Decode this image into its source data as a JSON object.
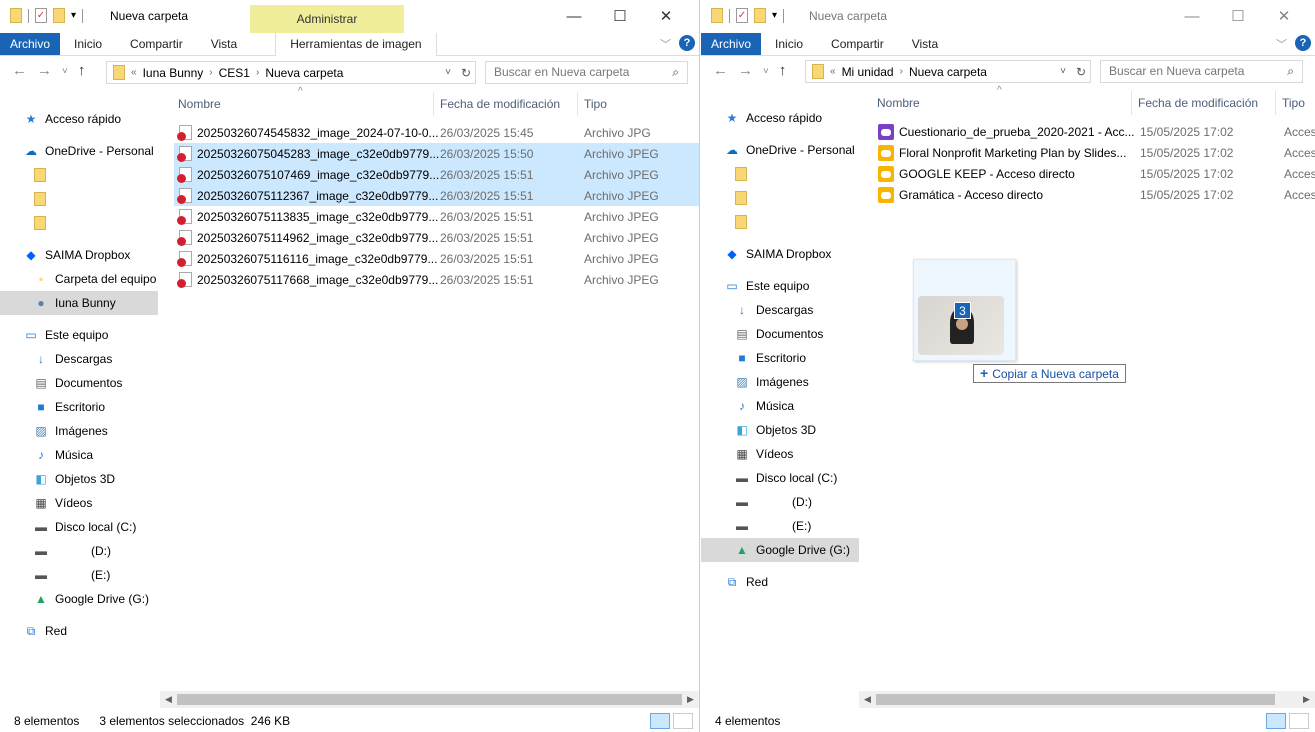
{
  "left": {
    "title": "Nueva carpeta",
    "context_tab_group": "Administrar",
    "tabs": [
      "Archivo",
      "Inicio",
      "Compartir",
      "Vista"
    ],
    "context_tab": "Herramientas de imagen",
    "address": [
      "Iuna Bunny",
      "CES1",
      "Nueva carpeta"
    ],
    "search_placeholder": "Buscar en Nueva carpeta",
    "columns": [
      "Nombre",
      "Fecha de modificación",
      "Tipo"
    ],
    "nav": [
      {
        "label": "Acceso rápido",
        "icon": "star-icon",
        "gap": false
      },
      {
        "label": "OneDrive - Personal",
        "icon": "cloud-icon",
        "gap": true
      },
      {
        "label": "",
        "icon": "folder-icon",
        "sub": true
      },
      {
        "label": "",
        "icon": "folder-icon",
        "sub": true
      },
      {
        "label": "",
        "icon": "folder-icon",
        "sub": true
      },
      {
        "label": "SAIMA Dropbox",
        "icon": "dropbox-icon",
        "gap": true
      },
      {
        "label": "Carpeta del equipo",
        "icon": "shared-folder-icon",
        "sub": true
      },
      {
        "label": "Iuna Bunny",
        "icon": "user-icon",
        "sub": true,
        "selected": true
      },
      {
        "label": "Este equipo",
        "icon": "computer-icon",
        "gap": true
      },
      {
        "label": "Descargas",
        "icon": "download-icon",
        "sub": true
      },
      {
        "label": "Documentos",
        "icon": "document-icon",
        "sub": true
      },
      {
        "label": "Escritorio",
        "icon": "desktop-icon",
        "sub": true
      },
      {
        "label": "Imágenes",
        "icon": "pictures-icon",
        "sub": true
      },
      {
        "label": "Música",
        "icon": "music-icon",
        "sub": true
      },
      {
        "label": "Objetos 3D",
        "icon": "cube-icon",
        "sub": true
      },
      {
        "label": "Vídeos",
        "icon": "video-icon",
        "sub": true
      },
      {
        "label": "Disco local (C:)",
        "icon": "drive-icon",
        "sub": true
      },
      {
        "label": "(D:)",
        "icon": "drive-icon",
        "sub": true,
        "indent": true
      },
      {
        "label": "(E:)",
        "icon": "drive-icon",
        "sub": true,
        "indent": true
      },
      {
        "label": "Google Drive (G:)",
        "icon": "google-drive-icon",
        "sub": true
      },
      {
        "label": "Red",
        "icon": "network-icon",
        "gap": true
      }
    ],
    "files": [
      {
        "name": "20250326074545832_image_2024-07-10-0...",
        "date": "26/03/2025 15:45",
        "type": "Archivo JPG",
        "selected": false
      },
      {
        "name": "20250326075045283_image_c32e0db9779...",
        "date": "26/03/2025 15:50",
        "type": "Archivo JPEG",
        "selected": true
      },
      {
        "name": "20250326075107469_image_c32e0db9779...",
        "date": "26/03/2025 15:51",
        "type": "Archivo JPEG",
        "selected": true
      },
      {
        "name": "20250326075112367_image_c32e0db9779...",
        "date": "26/03/2025 15:51",
        "type": "Archivo JPEG",
        "selected": true
      },
      {
        "name": "20250326075113835_image_c32e0db9779...",
        "date": "26/03/2025 15:51",
        "type": "Archivo JPEG",
        "selected": false
      },
      {
        "name": "20250326075114962_image_c32e0db9779...",
        "date": "26/03/2025 15:51",
        "type": "Archivo JPEG",
        "selected": false
      },
      {
        "name": "20250326075116116_image_c32e0db9779...",
        "date": "26/03/2025 15:51",
        "type": "Archivo JPEG",
        "selected": false
      },
      {
        "name": "20250326075117668_image_c32e0db9779...",
        "date": "26/03/2025 15:51",
        "type": "Archivo JPEG",
        "selected": false
      }
    ],
    "status_count": "8 elementos",
    "status_selection": "3 elementos seleccionados  246 KB"
  },
  "right": {
    "title": "Nueva carpeta",
    "tabs": [
      "Archivo",
      "Inicio",
      "Compartir",
      "Vista"
    ],
    "address": [
      "Mi unidad",
      "Nueva carpeta"
    ],
    "search_placeholder": "Buscar en Nueva carpeta",
    "columns": [
      "Nombre",
      "Fecha de modificación",
      "Tipo"
    ],
    "nav": [
      {
        "label": "Acceso rápido",
        "icon": "star-icon"
      },
      {
        "label": "OneDrive - Personal",
        "icon": "cloud-icon",
        "gap": true
      },
      {
        "label": "",
        "icon": "folder-icon",
        "sub": true
      },
      {
        "label": "",
        "icon": "folder-icon",
        "sub": true
      },
      {
        "label": "",
        "icon": "folder-icon",
        "sub": true
      },
      {
        "label": "SAIMA Dropbox",
        "icon": "dropbox-icon",
        "gap": true
      },
      {
        "label": "Este equipo",
        "icon": "computer-icon",
        "gap": true
      },
      {
        "label": "Descargas",
        "icon": "download-icon",
        "sub": true
      },
      {
        "label": "Documentos",
        "icon": "document-icon",
        "sub": true
      },
      {
        "label": "Escritorio",
        "icon": "desktop-icon",
        "sub": true
      },
      {
        "label": "Imágenes",
        "icon": "pictures-icon",
        "sub": true
      },
      {
        "label": "Música",
        "icon": "music-icon",
        "sub": true
      },
      {
        "label": "Objetos 3D",
        "icon": "cube-icon",
        "sub": true
      },
      {
        "label": "Vídeos",
        "icon": "video-icon",
        "sub": true
      },
      {
        "label": "Disco local (C:)",
        "icon": "drive-icon",
        "sub": true
      },
      {
        "label": "(D:)",
        "icon": "drive-icon",
        "sub": true,
        "indent": true
      },
      {
        "label": "(E:)",
        "icon": "drive-icon",
        "sub": true,
        "indent": true
      },
      {
        "label": "Google Drive (G:)",
        "icon": "google-drive-icon",
        "sub": true,
        "selected": true
      },
      {
        "label": "Red",
        "icon": "network-icon",
        "gap": true
      }
    ],
    "files": [
      {
        "name": "Cuestionario_de_prueba_2020-2021 - Acc...",
        "date": "15/05/2025 17:02",
        "type": "Acces",
        "icon": "purple"
      },
      {
        "name": "Floral Nonprofit Marketing Plan by Slides...",
        "date": "15/05/2025 17:02",
        "type": "Acces"
      },
      {
        "name": "GOOGLE KEEP - Acceso directo",
        "date": "15/05/2025 17:02",
        "type": "Acces"
      },
      {
        "name": "Gramática - Acceso directo",
        "date": "15/05/2025 17:02",
        "type": "Acces"
      }
    ],
    "status_count": "4 elementos"
  },
  "drag": {
    "count": "3",
    "tooltip": "Copiar a Nueva carpeta"
  }
}
